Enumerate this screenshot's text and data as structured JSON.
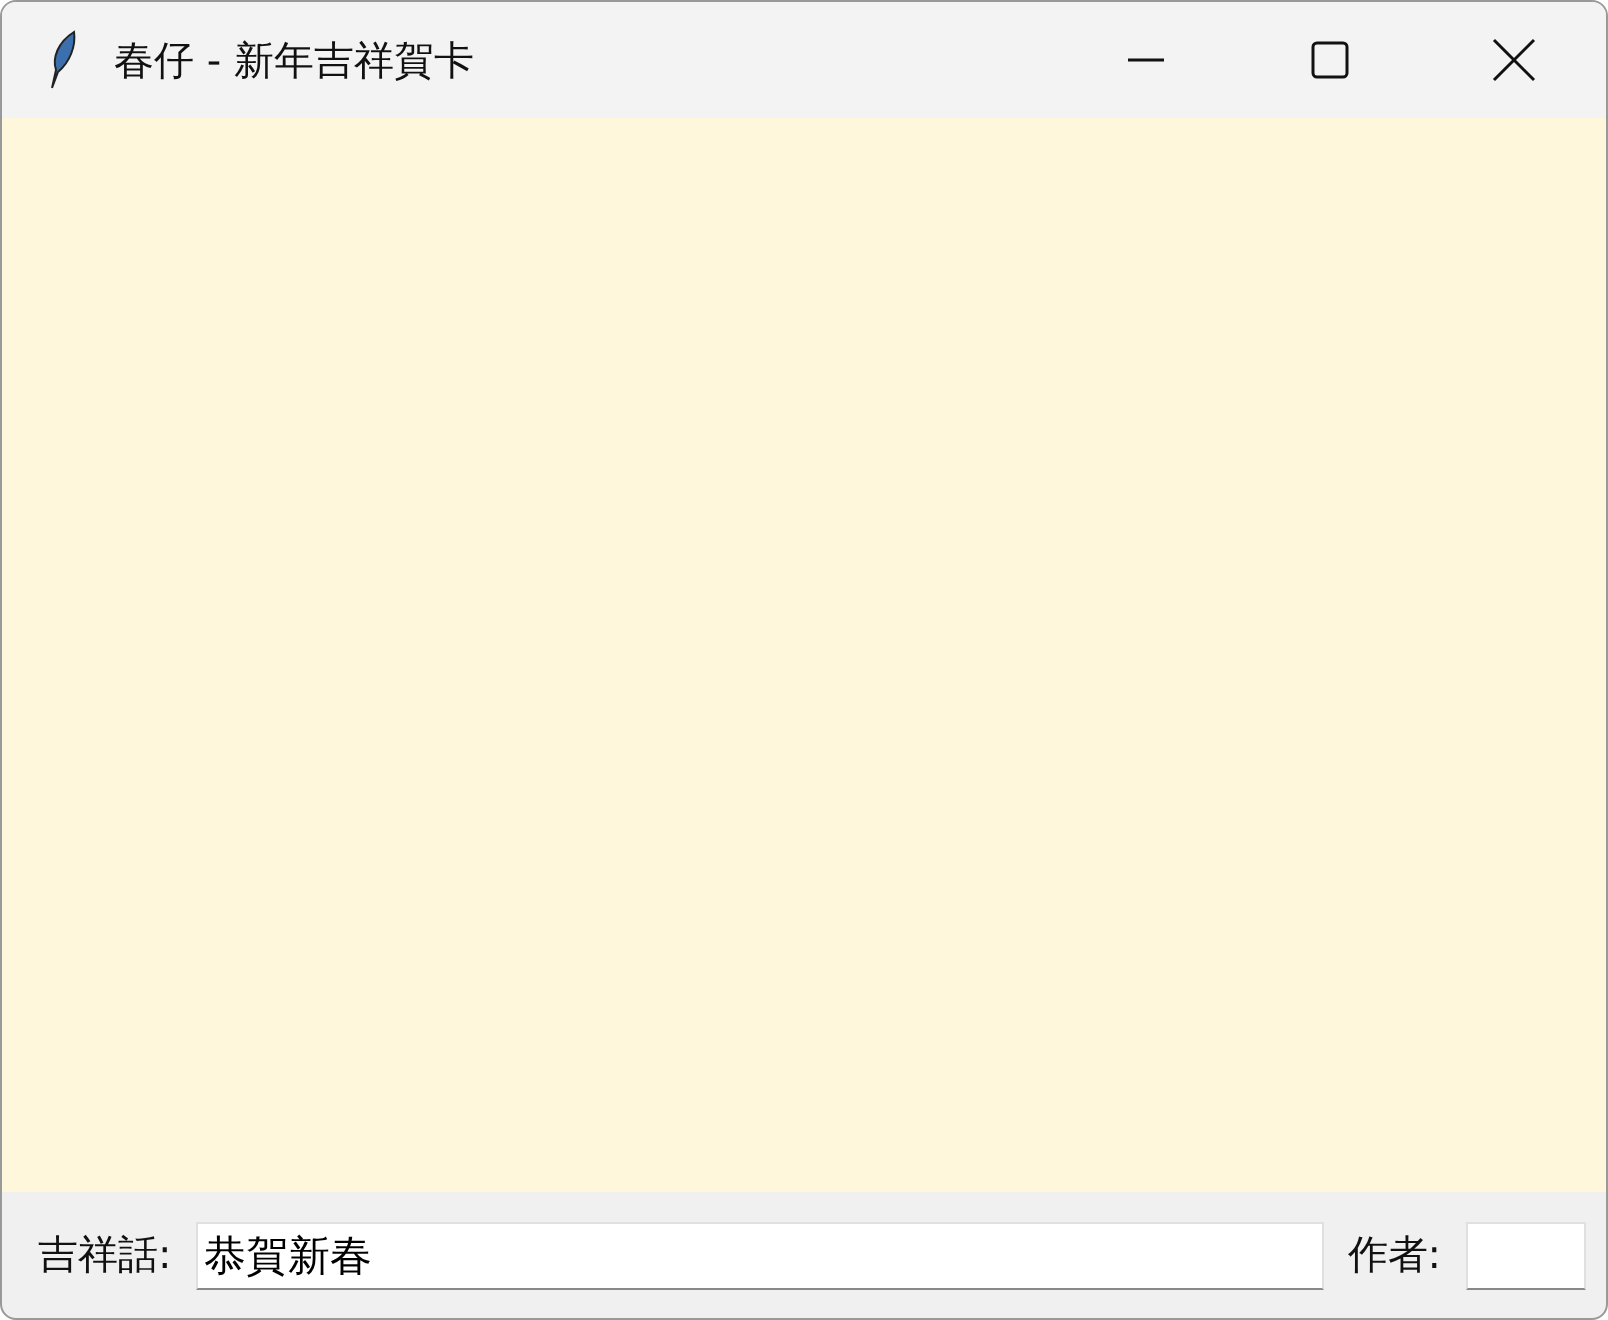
{
  "window": {
    "title": "春仔 - 新年吉祥賀卡"
  },
  "fields": [
    {
      "label": "吉祥話:",
      "value": "恭賀新春"
    },
    {
      "label": "作者:"
    }
  ]
}
